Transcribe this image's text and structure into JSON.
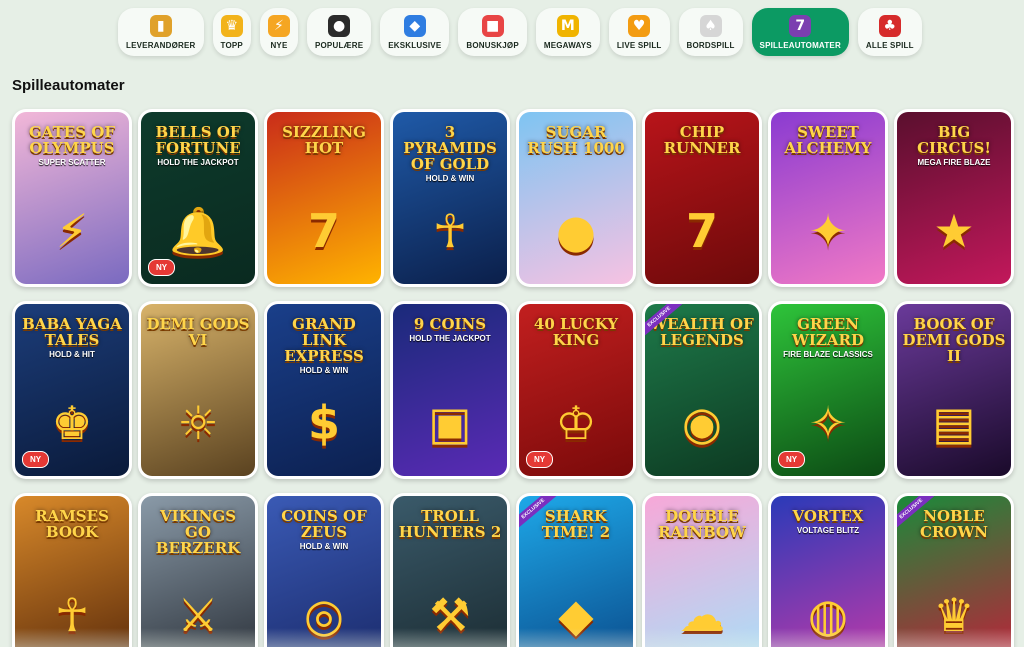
{
  "nav": [
    {
      "label": "LEVERANDØRER",
      "icon": "book-icon",
      "glyph": "▮",
      "color": "#e0a12a",
      "active": false
    },
    {
      "label": "TOPP",
      "icon": "crown-icon",
      "glyph": "♛",
      "color": "#f2b31a",
      "active": false
    },
    {
      "label": "NYE",
      "icon": "lightning-icon",
      "glyph": "⚡",
      "color": "#f5a623",
      "active": false
    },
    {
      "label": "POPULÆRE",
      "icon": "bomb-icon",
      "glyph": "●",
      "color": "#2b2b2b",
      "active": false
    },
    {
      "label": "EKSKLUSIVE",
      "icon": "diamond-icon",
      "glyph": "◆",
      "color": "#2f7de1",
      "active": false
    },
    {
      "label": "BONUSKJØP",
      "icon": "gift-icon",
      "glyph": "■",
      "color": "#e84545",
      "active": false
    },
    {
      "label": "MEGAWAYS",
      "icon": "megaways-icon",
      "glyph": "M",
      "color": "#f0b400",
      "active": false
    },
    {
      "label": "LIVE SPILL",
      "icon": "live-heart-icon",
      "glyph": "♥",
      "color": "#f39c12",
      "active": false
    },
    {
      "label": "BORDSPILL",
      "icon": "cards-icon",
      "glyph": "♠",
      "color": "#d6d6d6",
      "active": false
    },
    {
      "label": "SPILLEAUTOMATER",
      "icon": "slot-machine-icon",
      "glyph": "7",
      "color": "#7b3fb0",
      "active": true
    },
    {
      "label": "ALLE SPILL",
      "icon": "cherry-icon",
      "glyph": "♣",
      "color": "#d62b2b",
      "active": false
    }
  ],
  "section_title": "Spilleautomater",
  "badge_new": "NY",
  "ribbon_label": "EXCLUSIVE",
  "games": [
    {
      "title": "Gates of Olympus",
      "sub": "SUPER SCATTER",
      "emblem": "⚡",
      "bg": [
        "#f2b7d8",
        "#7a6ac0"
      ],
      "ny": false,
      "exclusive": false
    },
    {
      "title": "Bells of Fortune",
      "sub": "HOLD THE JACKPOT",
      "emblem": "🔔",
      "bg": [
        "#0e3b2c",
        "#0a2a20"
      ],
      "ny": true,
      "exclusive": false
    },
    {
      "title": "Sizzling Hot",
      "sub": "",
      "emblem": "7",
      "bg": [
        "#c92c1a",
        "#ffb300"
      ],
      "ny": false,
      "exclusive": false
    },
    {
      "title": "3 Pyramids of Gold",
      "sub": "HOLD & WIN",
      "emblem": "☥",
      "bg": [
        "#1f5aa8",
        "#0b1f4a"
      ],
      "ny": false,
      "exclusive": false
    },
    {
      "title": "Sugar Rush 1000",
      "sub": "",
      "emblem": "●",
      "bg": [
        "#7ec4f2",
        "#f6c2e2"
      ],
      "ny": false,
      "exclusive": false
    },
    {
      "title": "Chip Runner",
      "sub": "",
      "emblem": "7",
      "bg": [
        "#b8141a",
        "#6d0a0a"
      ],
      "ny": false,
      "exclusive": false
    },
    {
      "title": "Sweet Alchemy",
      "sub": "",
      "emblem": "✦",
      "bg": [
        "#8a3bd1",
        "#f179c5"
      ],
      "ny": false,
      "exclusive": false
    },
    {
      "title": "Big Circus!",
      "sub": "MEGA FIRE BLAZE",
      "emblem": "★",
      "bg": [
        "#5a0f2e",
        "#c2185b"
      ],
      "ny": false,
      "exclusive": false
    },
    {
      "title": "Baba Yaga Tales",
      "sub": "HOLD & HIT",
      "emblem": "♚",
      "bg": [
        "#1c3d7a",
        "#0a1a3a"
      ],
      "ny": true,
      "exclusive": false
    },
    {
      "title": "Demi Gods VI",
      "sub": "",
      "emblem": "☼",
      "bg": [
        "#d8b36a",
        "#5a4220"
      ],
      "ny": false,
      "exclusive": false
    },
    {
      "title": "Grand Link Express",
      "sub": "HOLD & WIN",
      "emblem": "$",
      "bg": [
        "#1a3f8a",
        "#0c2050"
      ],
      "ny": false,
      "exclusive": false
    },
    {
      "title": "9 Coins",
      "sub": "HOLD THE JACKPOT",
      "emblem": "▣",
      "bg": [
        "#1a2a7a",
        "#5a2ab5"
      ],
      "ny": false,
      "exclusive": false
    },
    {
      "title": "40 Lucky King",
      "sub": "",
      "emblem": "♔",
      "bg": [
        "#c21f1f",
        "#7a0a0a"
      ],
      "ny": true,
      "exclusive": false
    },
    {
      "title": "Wealth of Legends",
      "sub": "",
      "emblem": "◉",
      "bg": [
        "#1e7a4a",
        "#0d3a22"
      ],
      "ny": false,
      "exclusive": true
    },
    {
      "title": "Green Wizard",
      "sub": "FIRE BLAZE CLASSICS",
      "emblem": "✧",
      "bg": [
        "#2ec43a",
        "#0c4a14"
      ],
      "ny": true,
      "exclusive": false
    },
    {
      "title": "Book of Demi Gods II",
      "sub": "",
      "emblem": "▤",
      "bg": [
        "#6a3a9a",
        "#1a0a2a"
      ],
      "ny": false,
      "exclusive": false
    },
    {
      "title": "Ramses Book",
      "sub": "",
      "emblem": "☥",
      "bg": [
        "#d8892a",
        "#5a2a0a"
      ],
      "ny": false,
      "exclusive": false
    },
    {
      "title": "Vikings go Berzerk",
      "sub": "",
      "emblem": "⚔",
      "bg": [
        "#8a9aa8",
        "#2a3038"
      ],
      "ny": false,
      "exclusive": false
    },
    {
      "title": "Coins of Zeus",
      "sub": "HOLD & WIN",
      "emblem": "◎",
      "bg": [
        "#3a5ab5",
        "#1a2a6a"
      ],
      "ny": false,
      "exclusive": false
    },
    {
      "title": "Troll Hunters 2",
      "sub": "",
      "emblem": "⚒",
      "bg": [
        "#3a5a6a",
        "#1a2a30"
      ],
      "ny": false,
      "exclusive": false
    },
    {
      "title": "Shark Time! 2",
      "sub": "",
      "emblem": "◆",
      "bg": [
        "#1ea8e8",
        "#0a4a8a"
      ],
      "ny": false,
      "exclusive": true
    },
    {
      "title": "Double Rainbow",
      "sub": "",
      "emblem": "☁",
      "bg": [
        "#f7a8d8",
        "#a8e0f8"
      ],
      "ny": false,
      "exclusive": false
    },
    {
      "title": "Vortex",
      "sub": "VOLTAGE BLITZ",
      "emblem": "◍",
      "bg": [
        "#2a3ab8",
        "#c23aa8"
      ],
      "ny": false,
      "exclusive": false
    },
    {
      "title": "Noble Crown",
      "sub": "",
      "emblem": "♛",
      "bg": [
        "#1a8a3a",
        "#c21f3a"
      ],
      "ny": false,
      "exclusive": true
    }
  ]
}
